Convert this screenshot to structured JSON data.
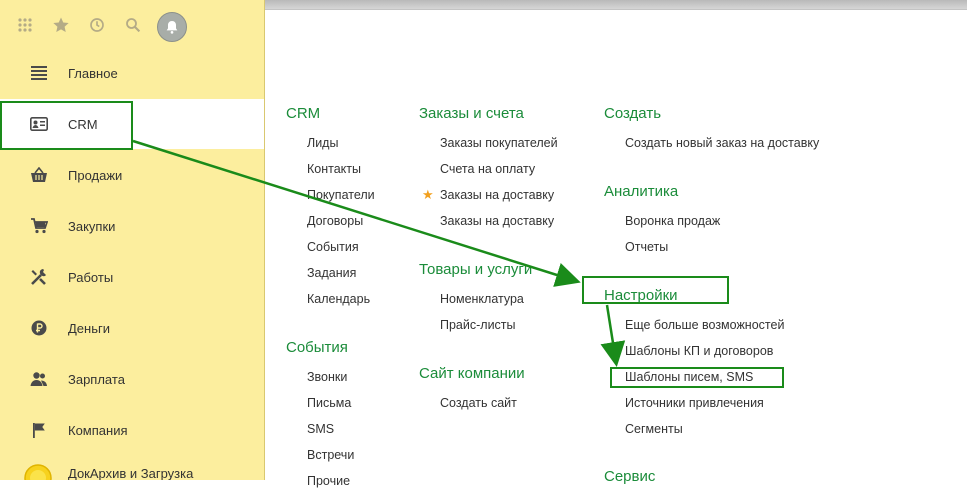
{
  "sidebar": {
    "items": [
      {
        "label": "Главное",
        "icon": "menu-lines-icon"
      },
      {
        "label": "CRM",
        "icon": "contact-card-icon"
      },
      {
        "label": "Продажи",
        "icon": "basket-icon"
      },
      {
        "label": "Закупки",
        "icon": "cart-icon"
      },
      {
        "label": "Работы",
        "icon": "tools-icon"
      },
      {
        "label": "Деньги",
        "icon": "ruble-coin-icon"
      },
      {
        "label": "Зарплата",
        "icon": "people-icon"
      },
      {
        "label": "Компания",
        "icon": "flag-icon"
      },
      {
        "label": "ДокАрхив и Загрузка",
        "icon": "docarchive-logo-icon"
      }
    ]
  },
  "main": {
    "crm": {
      "title": "CRM",
      "links": [
        "Лиды",
        "Контакты",
        "Покупатели",
        "Договоры",
        "События",
        "Задания",
        "Календарь"
      ]
    },
    "events": {
      "title": "События",
      "links": [
        "Звонки",
        "Письма",
        "SMS",
        "Встречи",
        "Прочие"
      ]
    },
    "orders": {
      "title": "Заказы и счета",
      "links": [
        "Заказы покупателей",
        "Счета на оплату",
        "Заказы на доставку",
        "Заказы на доставку"
      ]
    },
    "goods": {
      "title": "Товары и услуги",
      "links": [
        "Номенклатура",
        "Прайс-листы"
      ]
    },
    "site": {
      "title": "Сайт компании",
      "links": [
        "Создать сайт"
      ]
    },
    "create": {
      "title": "Создать",
      "links": [
        "Создать новый заказ на доставку"
      ]
    },
    "analytics": {
      "title": "Аналитика",
      "links": [
        "Воронка продаж",
        "Отчеты"
      ]
    },
    "settings": {
      "title": "Настройки",
      "links": [
        "Еще больше возможностей",
        "Шаблоны КП и договоров",
        "Шаблоны писем, SMS",
        "Источники привлечения",
        "Сегменты"
      ]
    },
    "service": {
      "title": "Сервис"
    }
  },
  "colors": {
    "sidebar_bg": "#fcee9e",
    "group_title": "#1b8c3a",
    "highlight": "#1a8b1a",
    "star": "#f2a01e"
  }
}
